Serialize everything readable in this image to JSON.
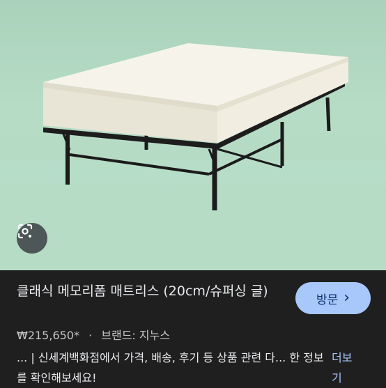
{
  "product": {
    "title": "클래식 메모리폼 매트리스 (20cm/슈퍼싱 글)",
    "price": "₩215,650*",
    "separator": "·",
    "brand": "브랜드: 지누스",
    "snippet": "... | 신세계백화점에서 가격, 배송, 후기 등 상품 관련 다... 한 정보를 확인해보세요!",
    "more_label": "더보 기"
  },
  "actions": {
    "visit_label": "방문",
    "visit_chevron": "›"
  },
  "icons": {
    "lens": "google-lens-icon",
    "chevron": "chevron-right-icon"
  },
  "colors": {
    "background": "#1f1f1f",
    "accent": "#a8c7fa",
    "photo_backdrop": "#b3d9c3"
  }
}
